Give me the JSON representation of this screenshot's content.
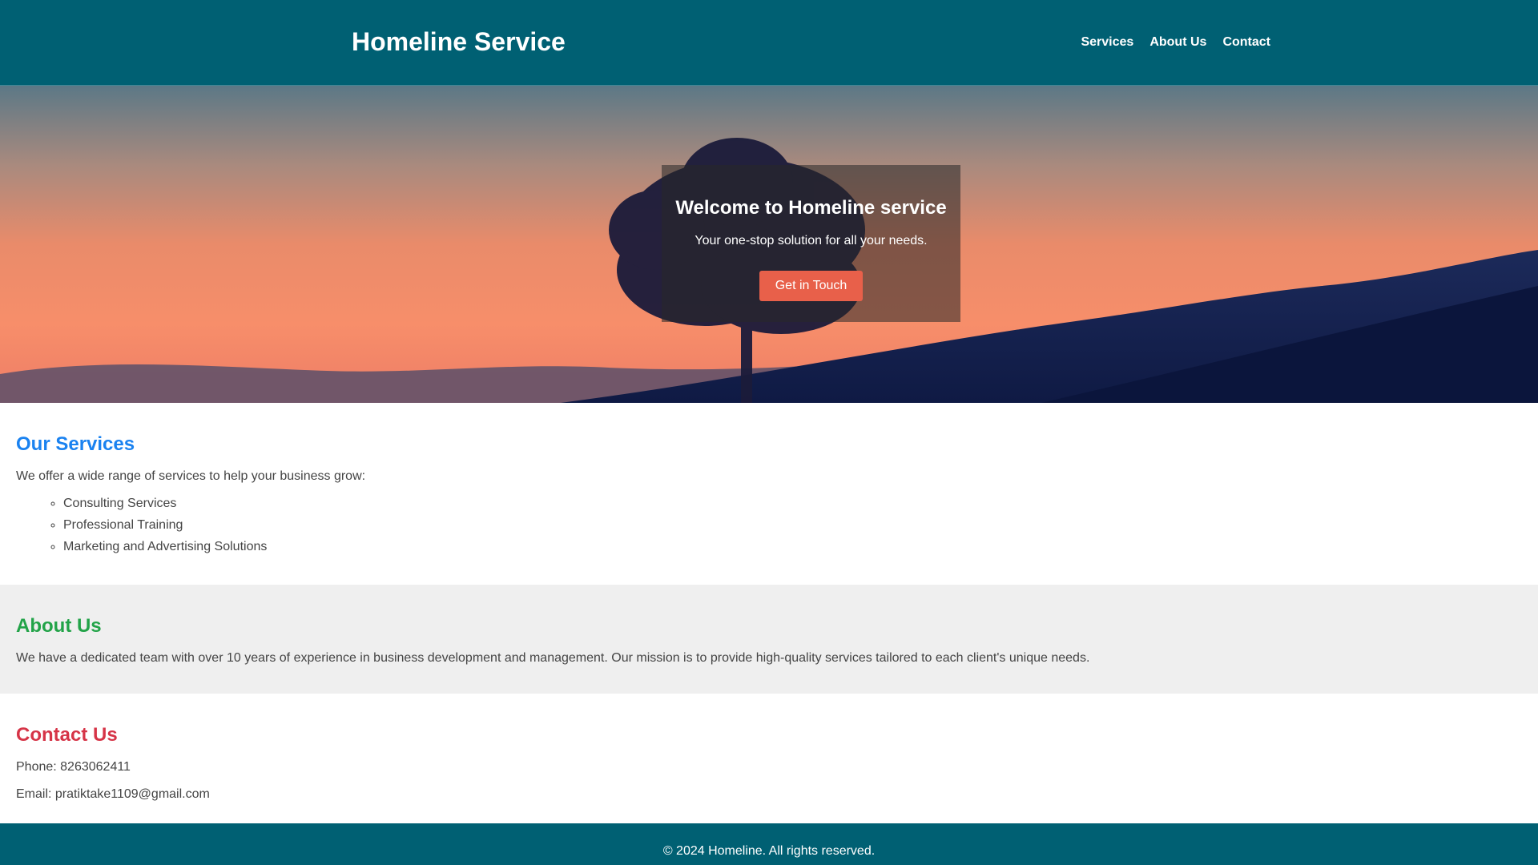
{
  "header": {
    "brand": "Homeline Service",
    "nav": [
      "Services",
      "About Us",
      "Contact"
    ]
  },
  "hero": {
    "title": "Welcome to Homeline service",
    "subtitle": "Your one-stop solution for all your needs.",
    "button": "Get in Touch"
  },
  "services": {
    "heading": "Our Services",
    "intro": "We offer a wide range of services to help your business grow:",
    "items": [
      "Consulting Services",
      "Professional Training",
      "Marketing and Advertising Solutions"
    ]
  },
  "about": {
    "heading": "About Us",
    "text": "We have a dedicated team with over 10 years of experience in business development and management. Our mission is to provide high-quality services tailored to each client's unique needs."
  },
  "contact": {
    "heading": "Contact Us",
    "phone": "Phone: 8263062411",
    "email": "Email: pratiktake1109@gmail.com"
  },
  "footer": {
    "text": "© 2024 Homeline. All rights reserved."
  },
  "colors": {
    "header_bg": "#006073",
    "button_bg": "#e8604a",
    "services_heading": "#1a82f0",
    "about_heading": "#22a348",
    "contact_heading": "#d63447"
  }
}
